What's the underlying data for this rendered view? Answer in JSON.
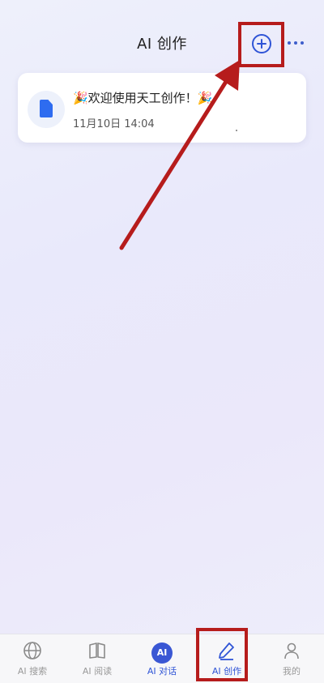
{
  "header": {
    "title": "AI 创作"
  },
  "card": {
    "title": "🎉欢迎使用天工创作！🎉",
    "date": "11月10日 14:04"
  },
  "tabs": [
    {
      "label": "AI 搜索",
      "icon": "globe-icon",
      "active": false
    },
    {
      "label": "AI 阅读",
      "icon": "book-icon",
      "active": false
    },
    {
      "label": "AI 对话",
      "icon": "ai-chat-icon",
      "active": false
    },
    {
      "label": "AI 创作",
      "icon": "pen-icon",
      "active": true
    },
    {
      "label": "我的",
      "icon": "user-icon",
      "active": false
    }
  ],
  "ai_badge": "AI",
  "colors": {
    "accent": "#2f54d6",
    "highlight": "#b61c1c",
    "doc_icon": "#2e6cf0"
  }
}
